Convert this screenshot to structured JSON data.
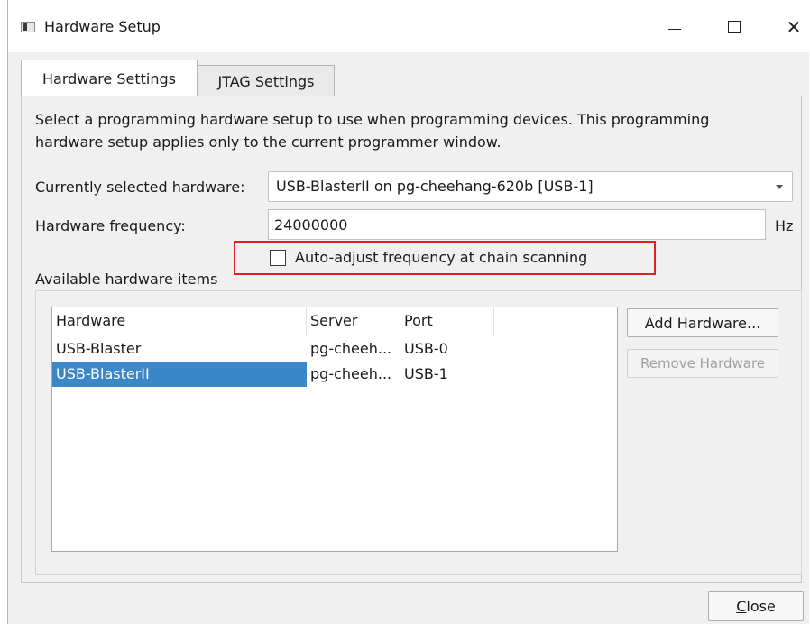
{
  "window": {
    "title": "Hardware Setup",
    "minimize_icon": "minimize-icon",
    "maximize_icon": "maximize-icon",
    "close_glyph": "✕"
  },
  "tabs": [
    {
      "label": "Hardware Settings",
      "active": true
    },
    {
      "label": "JTAG Settings",
      "active": false
    }
  ],
  "description": "Select a programming hardware setup to use when programming devices. This programming hardware setup applies only to the current programmer window.",
  "selected_hardware": {
    "label": "Currently selected hardware:",
    "value": "USB-BlasterII on pg-cheehang-620b [USB-1]"
  },
  "frequency": {
    "label": "Hardware frequency:",
    "value": "24000000",
    "unit": "Hz"
  },
  "auto_adjust": {
    "label": "Auto-adjust frequency at chain scanning",
    "checked": false,
    "highlight_color": "#e0202a"
  },
  "available": {
    "label": "Available hardware items",
    "columns": [
      "Hardware",
      "Server",
      "Port"
    ],
    "rows": [
      {
        "hardware": "USB-Blaster",
        "server": "pg-cheeh...",
        "port": "USB-0",
        "selected": false
      },
      {
        "hardware": "USB-BlasterII",
        "server": "pg-cheeh...",
        "port": "USB-1",
        "selected": true
      }
    ],
    "selection_color": "#3c87c8"
  },
  "buttons": {
    "add": "Add Hardware...",
    "remove": "Remove Hardware",
    "close_underlined": "C",
    "close_rest": "lose"
  }
}
